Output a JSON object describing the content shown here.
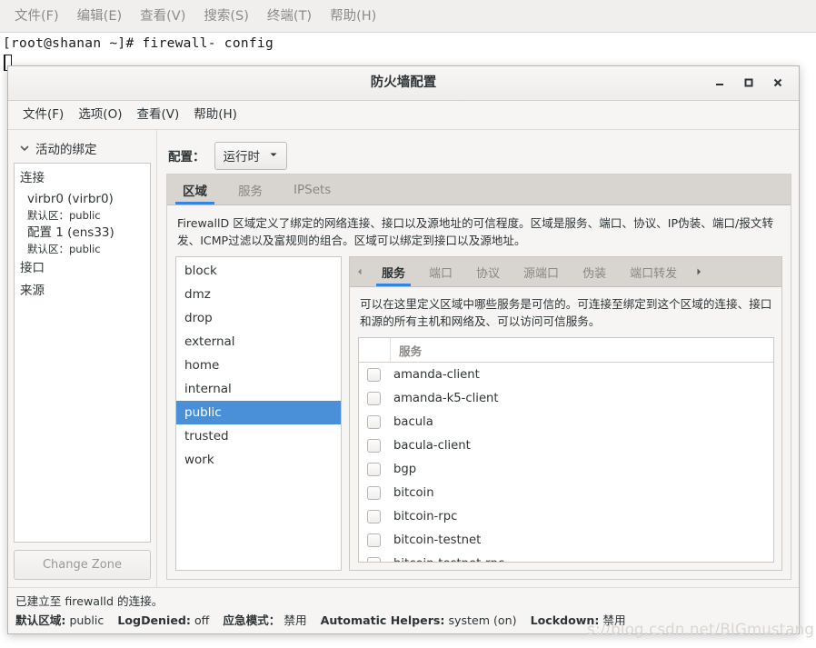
{
  "terminal": {
    "menu": [
      "文件(F)",
      "编辑(E)",
      "查看(V)",
      "搜索(S)",
      "终端(T)",
      "帮助(H)"
    ],
    "prompt_line": "[root@shanan ~]# firewall- config"
  },
  "window": {
    "title": "防火墙配置",
    "controls": {
      "minimize": "minimize-icon",
      "maximize": "maximize-icon",
      "close": "close-icon"
    },
    "menu": [
      "文件(F)",
      "选项(O)",
      "查看(V)",
      "帮助(H)"
    ]
  },
  "sidebar": {
    "header": "活动的绑定",
    "chevron": "chevron-down-icon",
    "groups": [
      {
        "label": "连接",
        "children": [
          {
            "name": "virbr0 (virbr0)",
            "sub": "默认区：public"
          },
          {
            "name": "配置 1 (ens33)",
            "sub": "默认区：public"
          }
        ]
      },
      {
        "label": "接口",
        "children": []
      },
      {
        "label": "来源",
        "children": []
      }
    ],
    "change_zone_button": "Change Zone"
  },
  "main": {
    "config_label": "配置：",
    "config_value": "运行时",
    "config_caret": "chevron-down-icon",
    "tabs": [
      {
        "label": "区域",
        "active": true
      },
      {
        "label": "服务",
        "active": false
      },
      {
        "label": "IPSets",
        "active": false
      }
    ],
    "zone_description": "FirewallD 区域定义了绑定的网络连接、接口以及源地址的可信程度。区域是服务、端口、协议、IP伪装、端口/报文转发、ICMP过滤以及富规则的组合。区域可以绑定到接口以及源地址。",
    "zones": [
      {
        "name": "block",
        "selected": false
      },
      {
        "name": "dmz",
        "selected": false
      },
      {
        "name": "drop",
        "selected": false
      },
      {
        "name": "external",
        "selected": false
      },
      {
        "name": "home",
        "selected": false
      },
      {
        "name": "internal",
        "selected": false
      },
      {
        "name": "public",
        "selected": true
      },
      {
        "name": "trusted",
        "selected": false
      },
      {
        "name": "work",
        "selected": false
      }
    ],
    "inner_tabs": {
      "scroll_left": "chevron-left-icon",
      "scroll_right": "chevron-right-icon",
      "items": [
        {
          "label": "服务",
          "active": true
        },
        {
          "label": "端口",
          "active": false
        },
        {
          "label": "协议",
          "active": false
        },
        {
          "label": "源端口",
          "active": false
        },
        {
          "label": "伪装",
          "active": false
        },
        {
          "label": "端口转发",
          "active": false
        }
      ]
    },
    "service_description": "可以在这里定义区域中哪些服务是可信的。可连接至绑定到这个区域的连接、接口和源的所有主机和网络及、可以访问可信服务。",
    "service_column_header": "服务",
    "services": [
      {
        "name": "amanda-client",
        "checked": false
      },
      {
        "name": "amanda-k5-client",
        "checked": false
      },
      {
        "name": "bacula",
        "checked": false
      },
      {
        "name": "bacula-client",
        "checked": false
      },
      {
        "name": "bgp",
        "checked": false
      },
      {
        "name": "bitcoin",
        "checked": false
      },
      {
        "name": "bitcoin-rpc",
        "checked": false
      },
      {
        "name": "bitcoin-testnet",
        "checked": false
      },
      {
        "name": "bitcoin-testnet-rpc",
        "checked": false
      }
    ]
  },
  "statusbar": {
    "connection": "已建立至 firewalld 的连接。",
    "fields": [
      {
        "key": "默认区域:",
        "value": "public"
      },
      {
        "key": "LogDenied:",
        "value": "off"
      },
      {
        "key": "应急模式：",
        "value": "禁用"
      },
      {
        "key": "Automatic Helpers:",
        "value": "system (on)"
      },
      {
        "key": "Lockdown:",
        "value": "禁用"
      }
    ]
  },
  "watermark": "s://blog.csdn.net/BIGmustang",
  "colors": {
    "selection_blue": "#4a90d9",
    "tab_underline": "#3584e4",
    "window_bg": "#f6f5f4",
    "tabstrip_bg": "#d8d4d0"
  }
}
